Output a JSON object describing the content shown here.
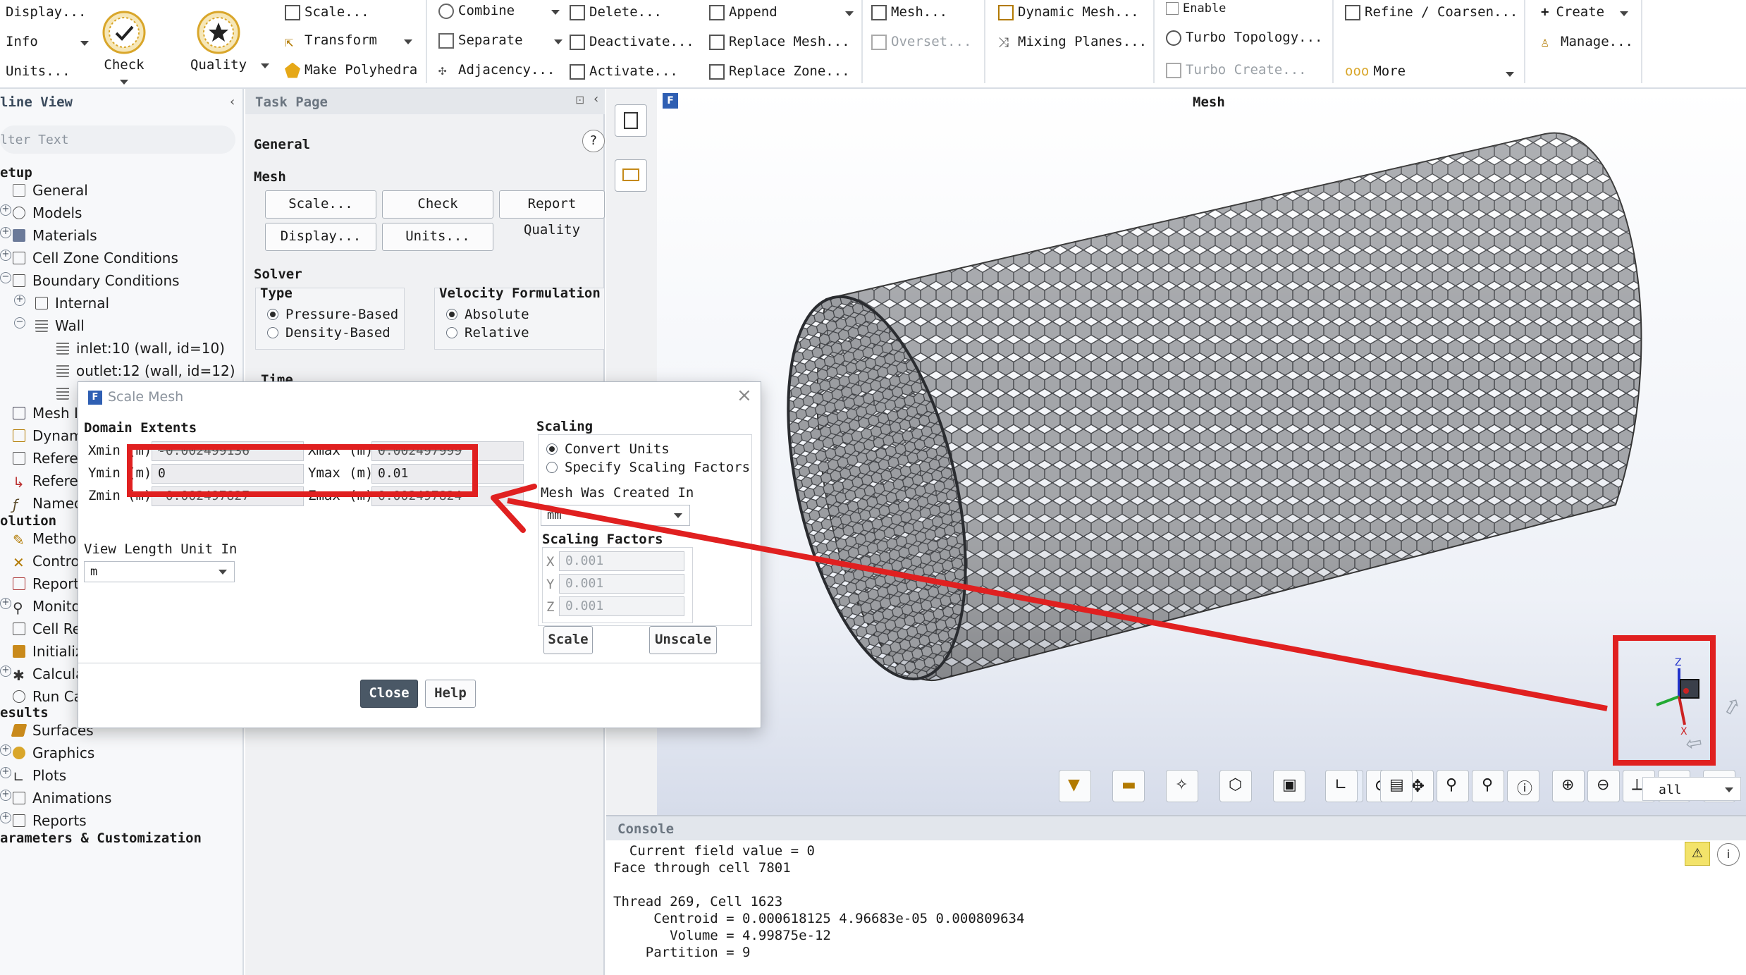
{
  "ribbon": {
    "col1": [
      "Display...",
      "Info",
      "Units..."
    ],
    "check_label": "Check",
    "quality_label": "Quality",
    "col3": [
      "Scale...",
      "Transform",
      "Make Polyhedra"
    ],
    "col4": [
      "Combine",
      "Separate",
      "Adjacency..."
    ],
    "col5": [
      "Delete...",
      "Deactivate...",
      "Activate..."
    ],
    "col6": [
      "Append",
      "Replace Mesh...",
      "Replace Zone..."
    ],
    "col7": [
      "Mesh...",
      "Overset..."
    ],
    "col8": [
      "Dynamic Mesh...",
      "Mixing Planes..."
    ],
    "col9": [
      "Enable",
      "Turbo Topology...",
      "Turbo Create..."
    ],
    "col10": [
      "Refine / Coarsen...",
      "More"
    ],
    "col11": [
      "Create",
      "Manage..."
    ]
  },
  "outline": {
    "title": "line View",
    "filter_placeholder": "lter Text",
    "setup_header": "etup",
    "items": [
      "General",
      "Models",
      "Materials",
      "Cell Zone Conditions",
      "Boundary Conditions",
      "Internal",
      "Wall",
      "inlet:10 (wall, id=10)",
      "outlet:12 (wall, id=12)"
    ],
    "items2": [
      "Mesh I",
      "Dynam",
      "Refere",
      "Refere",
      "Named"
    ],
    "solution_header": "olution",
    "solution_items": [
      "Metho",
      "Contro",
      "Report",
      "Monito",
      "Cell Re",
      "Initializ",
      "Calcula",
      "Run Ca"
    ],
    "results_header": "esults",
    "results_items": [
      "Surfaces",
      "Graphics",
      "Plots",
      "Animations",
      "Reports"
    ],
    "params_header": "arameters & Customization"
  },
  "task_page": {
    "title": "Task Page",
    "general": "General",
    "mesh": "Mesh",
    "buttons": [
      "Scale...",
      "Check",
      "Report Quality",
      "Display...",
      "Units..."
    ],
    "solver": "Solver",
    "type_label": "Type",
    "type_options": [
      "Pressure-Based",
      "Density-Based"
    ],
    "velocity_label": "Velocity Formulation",
    "velocity_options": [
      "Absolute",
      "Relative"
    ],
    "time_label": "Time"
  },
  "graphics": {
    "title": "Mesh",
    "view_select": "all"
  },
  "console": {
    "title": "Console",
    "lines": [
      "  Current field value = 0",
      "Face through cell 7801",
      "",
      "Thread 269, Cell 1623",
      "     Centroid = 0.000618125 4.96683e-05 0.000809634",
      "       Volume = 4.99875e-12",
      "    Partition = 9"
    ]
  },
  "dialog": {
    "title": "Scale Mesh",
    "domain_extents": "Domain Extents",
    "rows": [
      {
        "min_label": "Xmin",
        "min_unit": "(m)",
        "min_val": "-0.002499136",
        "max_label": "Xmax",
        "max_unit": "(m)",
        "max_val": "0.002497999"
      },
      {
        "min_label": "Ymin",
        "min_unit": "(m)",
        "min_val": "0",
        "max_label": "Ymax",
        "max_unit": "(m)",
        "max_val": "0.01"
      },
      {
        "min_label": "Zmin",
        "min_unit": "(m)",
        "min_val": "-0.002497827",
        "max_label": "Zmax",
        "max_unit": "(m)",
        "max_val": "0.002497824"
      }
    ],
    "view_length_unit_label": "View Length Unit In",
    "view_length_unit": "m",
    "scaling": "Scaling",
    "scaling_options": [
      "Convert Units",
      "Specify Scaling Factors"
    ],
    "mesh_created_in_label": "Mesh Was Created In",
    "mesh_created_in": "mm",
    "scaling_factors": "Scaling Factors",
    "factors": [
      {
        "axis": "X",
        "value": "0.001"
      },
      {
        "axis": "Y",
        "value": "0.001"
      },
      {
        "axis": "Z",
        "value": "0.001"
      }
    ],
    "scale_btn": "Scale",
    "unscale_btn": "Unscale",
    "close_btn": "Close",
    "help_btn": "Help"
  },
  "colors": {
    "annotation_red": "#e02020",
    "close_button": "#4a5866",
    "mesh_fill": "#9ea0a4"
  }
}
